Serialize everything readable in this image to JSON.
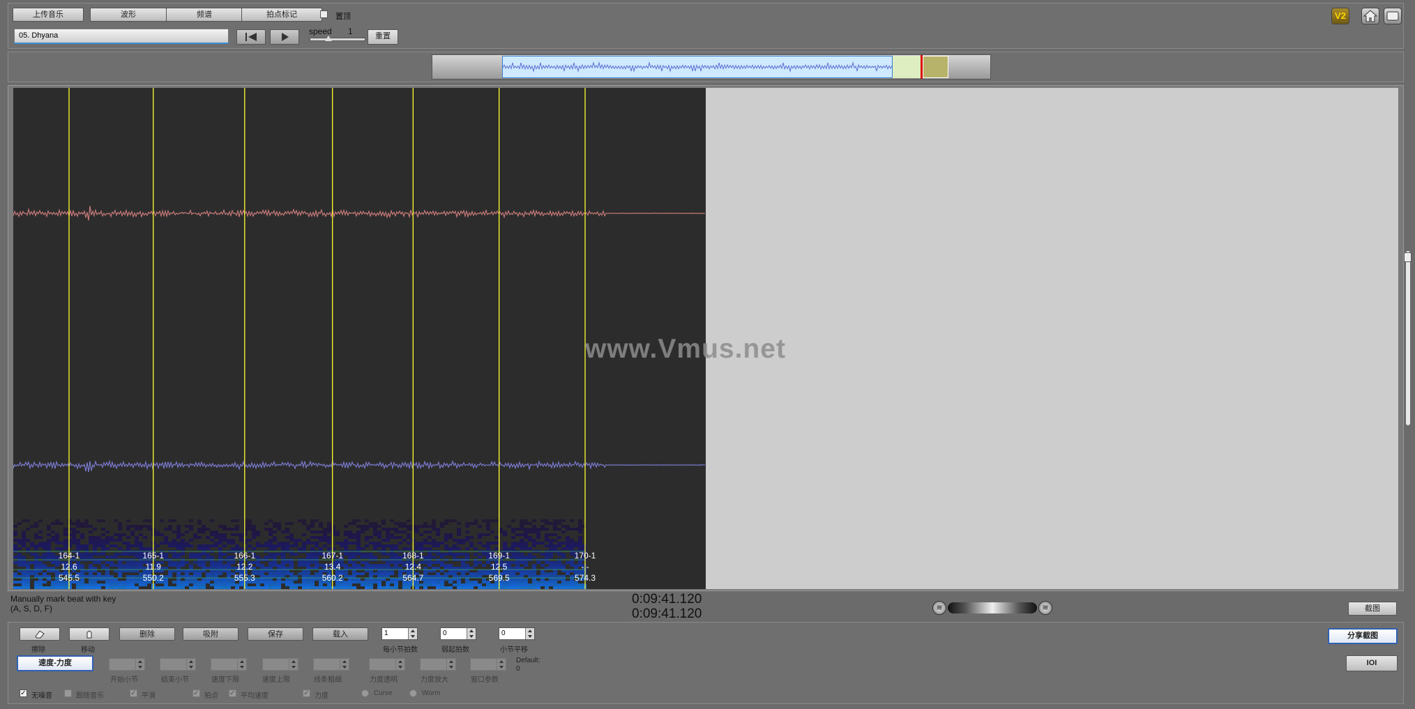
{
  "toolbar": {
    "upload_music": "上传音乐",
    "waveform": "波形",
    "spectrum": "频谱",
    "beat_mark": "拍点标记",
    "top_label": "置顶",
    "track_name": "05. Dhyana",
    "speed_label": "speed",
    "speed_value": "1",
    "reset": "重置"
  },
  "right_icons": {
    "v2": "V2"
  },
  "watermark": "www.Vmus.net",
  "beats": [
    {
      "label": "164-1",
      "tempo": "12.6",
      "time": "545.5"
    },
    {
      "label": "165-1",
      "tempo": "11.9",
      "time": "550.2"
    },
    {
      "label": "166-1",
      "tempo": "12.2",
      "time": "555.3"
    },
    {
      "label": "167-1",
      "tempo": "13.4",
      "time": "560.2"
    },
    {
      "label": "168-1",
      "tempo": "12.4",
      "time": "564.7"
    },
    {
      "label": "169-1",
      "tempo": "12.5",
      "time": "569.5"
    },
    {
      "label": "170-1",
      "tempo": "-.-",
      "time": "574.3"
    }
  ],
  "status": {
    "hint_line1": "Manually mark beat with key",
    "hint_line2": "(A, S, D, F)",
    "time1": "0:09:41.120",
    "time2": "0:09:41.120",
    "screenshot": "截图"
  },
  "bottom": {
    "erase_caption": "擦除",
    "move_caption": "移动",
    "delete": "删除",
    "snap": "吸附",
    "save": "保存",
    "load": "载入",
    "beats_per_bar_value": "1",
    "beats_per_bar_label": "每小节拍数",
    "weak_beats_value": "0",
    "weak_beats_label": "弱起拍数",
    "bar_shift_value": "0",
    "bar_shift_label": "小节平移",
    "tempo_dynamics": "速度-力度",
    "start_bar": "开始小节",
    "end_bar": "结束小节",
    "tempo_lower": "速度下限",
    "tempo_upper": "速度上限",
    "line_width": "线条粗细",
    "dyn_transparency": "力度透明",
    "dyn_zoom": "力度放大",
    "window_param": "窗口参数",
    "default_label": "Default:",
    "default_value": "0",
    "share_screenshot": "分享截图",
    "ioi": "IOI",
    "cb_nowave": "无噪音",
    "cb_follow": "跟随音乐",
    "cb_smooth": "平滑",
    "cb_beat": "拍点",
    "cb_avg_tempo": "平均速度",
    "cb_dynamics": "力度",
    "radio_curve": "Curve",
    "radio_worm": "Worm"
  },
  "colors": {
    "beat_line": "#ffff33",
    "wave_top": "#c97a7a",
    "wave_bottom": "#7a7ad0",
    "overview_selection": "#cfe9ff"
  }
}
